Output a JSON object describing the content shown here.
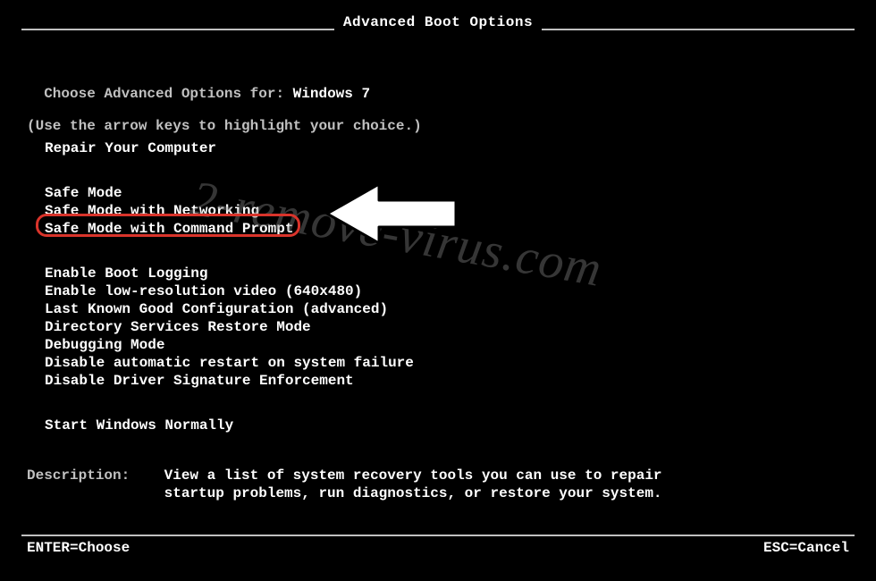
{
  "title": "Advanced Boot Options",
  "intro": {
    "prefix": "Choose Advanced Options for: ",
    "os": "Windows 7",
    "hint": "(Use the arrow keys to highlight your choice.)"
  },
  "group1": [
    "Repair Your Computer"
  ],
  "group2": [
    "Safe Mode",
    "Safe Mode with Networking",
    "Safe Mode with Command Prompt"
  ],
  "group3": [
    "Enable Boot Logging",
    "Enable low-resolution video (640x480)",
    "Last Known Good Configuration (advanced)",
    "Directory Services Restore Mode",
    "Debugging Mode",
    "Disable automatic restart on system failure",
    "Disable Driver Signature Enforcement"
  ],
  "group4": [
    "Start Windows Normally"
  ],
  "description": {
    "label": "Description:",
    "line1": "View a list of system recovery tools you can use to repair",
    "line2": "startup problems, run diagnostics, or restore your system."
  },
  "footer": {
    "enter": "ENTER=Choose",
    "esc": "ESC=Cancel"
  },
  "watermark": "2-remove-virus.com"
}
